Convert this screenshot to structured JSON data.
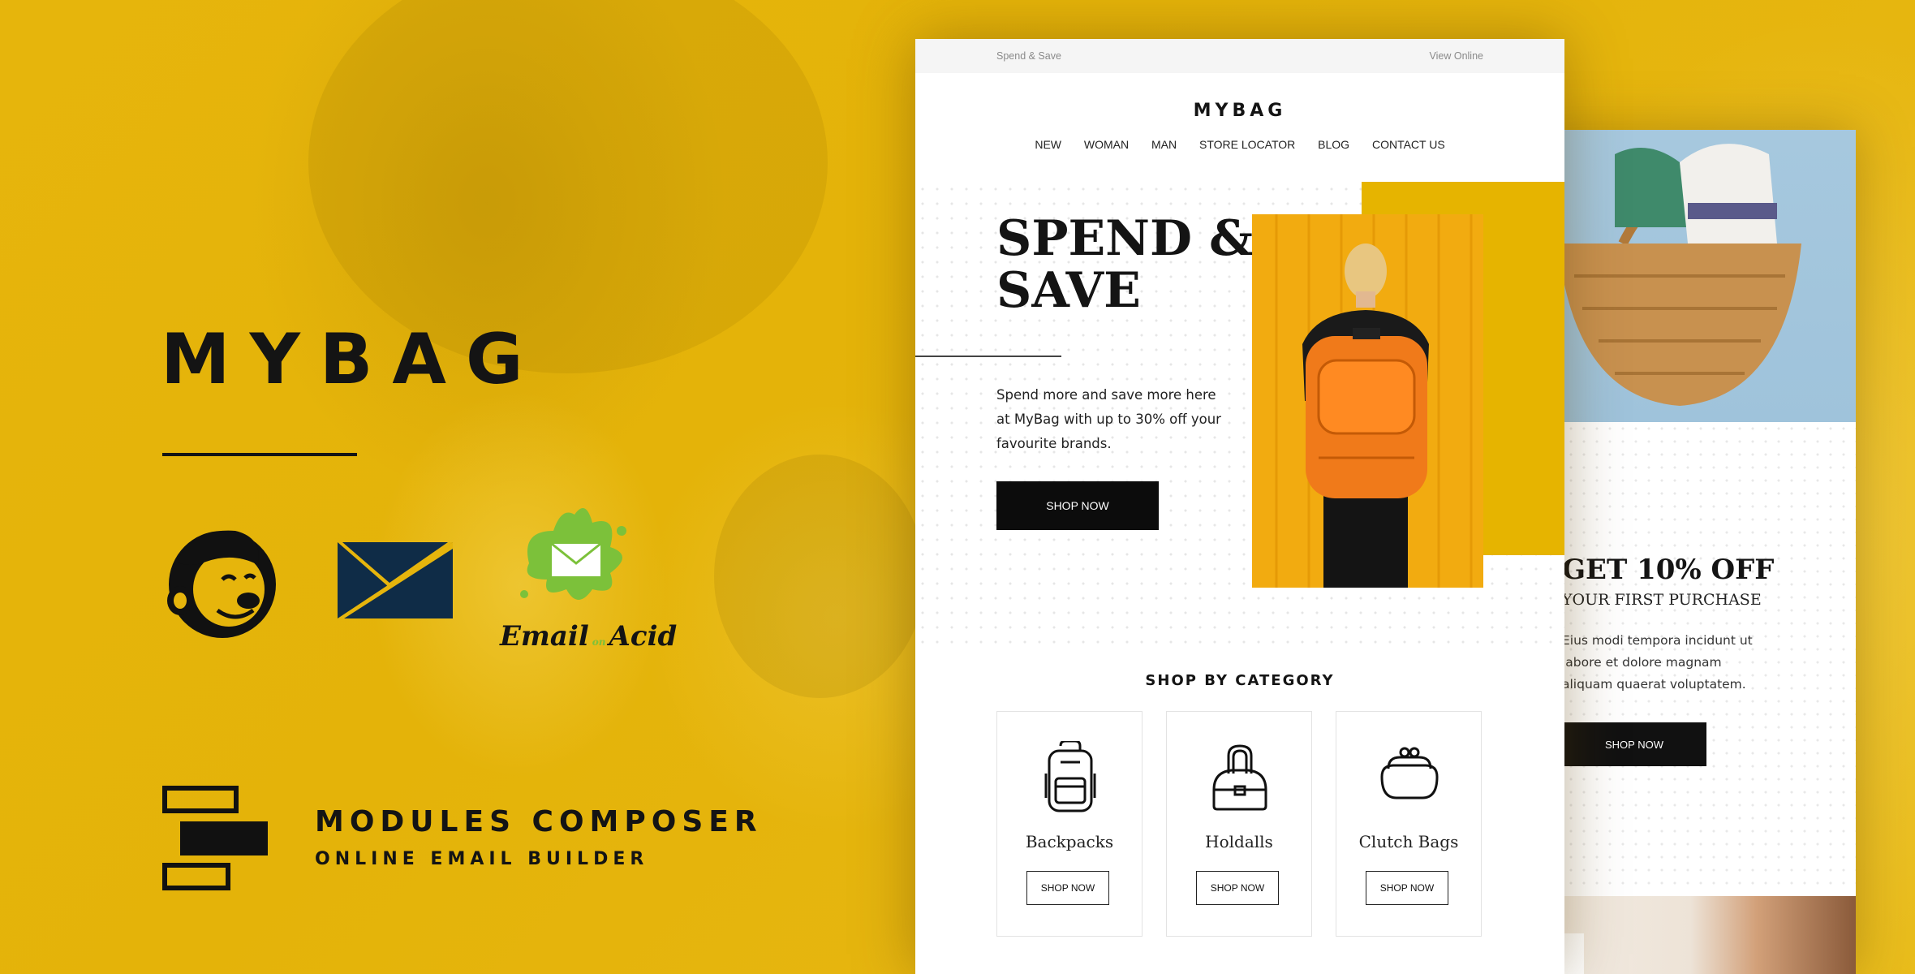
{
  "brand": {
    "title": "MYBAG",
    "composer_title": "MODULES COMPOSER",
    "composer_subtitle": "ONLINE EMAIL BUILDER"
  },
  "logos": [
    {
      "name": "mailchimp-logo"
    },
    {
      "name": "campaign-monitor-logo"
    },
    {
      "name": "email-on-acid-logo",
      "text_left": "Email",
      "text_on": "on",
      "text_right": "Acid"
    }
  ],
  "email_front": {
    "preheader": "Spend & Save",
    "view_online": "View Online",
    "logo": "MYBAG",
    "nav": [
      "NEW",
      "WOMAN",
      "MAN",
      "STORE LOCATOR",
      "BLOG",
      "CONTACT US"
    ],
    "hero": {
      "title_line1": "SPEND &",
      "title_line2": "SAVE",
      "text": "Spend more and save more here at MyBag with up to 30% off your favourite brands.",
      "button": "SHOP NOW"
    },
    "category_heading": "SHOP BY CATEGORY",
    "categories": [
      {
        "name": "Backpacks",
        "button": "SHOP NOW",
        "icon": "backpack-icon"
      },
      {
        "name": "Holdalls",
        "button": "SHOP NOW",
        "icon": "holdall-icon"
      },
      {
        "name": "Clutch Bags",
        "button": "SHOP NOW",
        "icon": "clutch-bag-icon"
      }
    ]
  },
  "email_back": {
    "title": "GET 10% OFF",
    "subtitle": "YOUR FIRST PURCHASE",
    "text": "Eius modi tempora incidunt ut labore et dolore magnam aliquam quaerat voluptatem.",
    "button": "SHOP NOW"
  },
  "colors": {
    "background": "#e6b50c",
    "accent_yellow": "#e6b400",
    "dark": "#141414"
  }
}
